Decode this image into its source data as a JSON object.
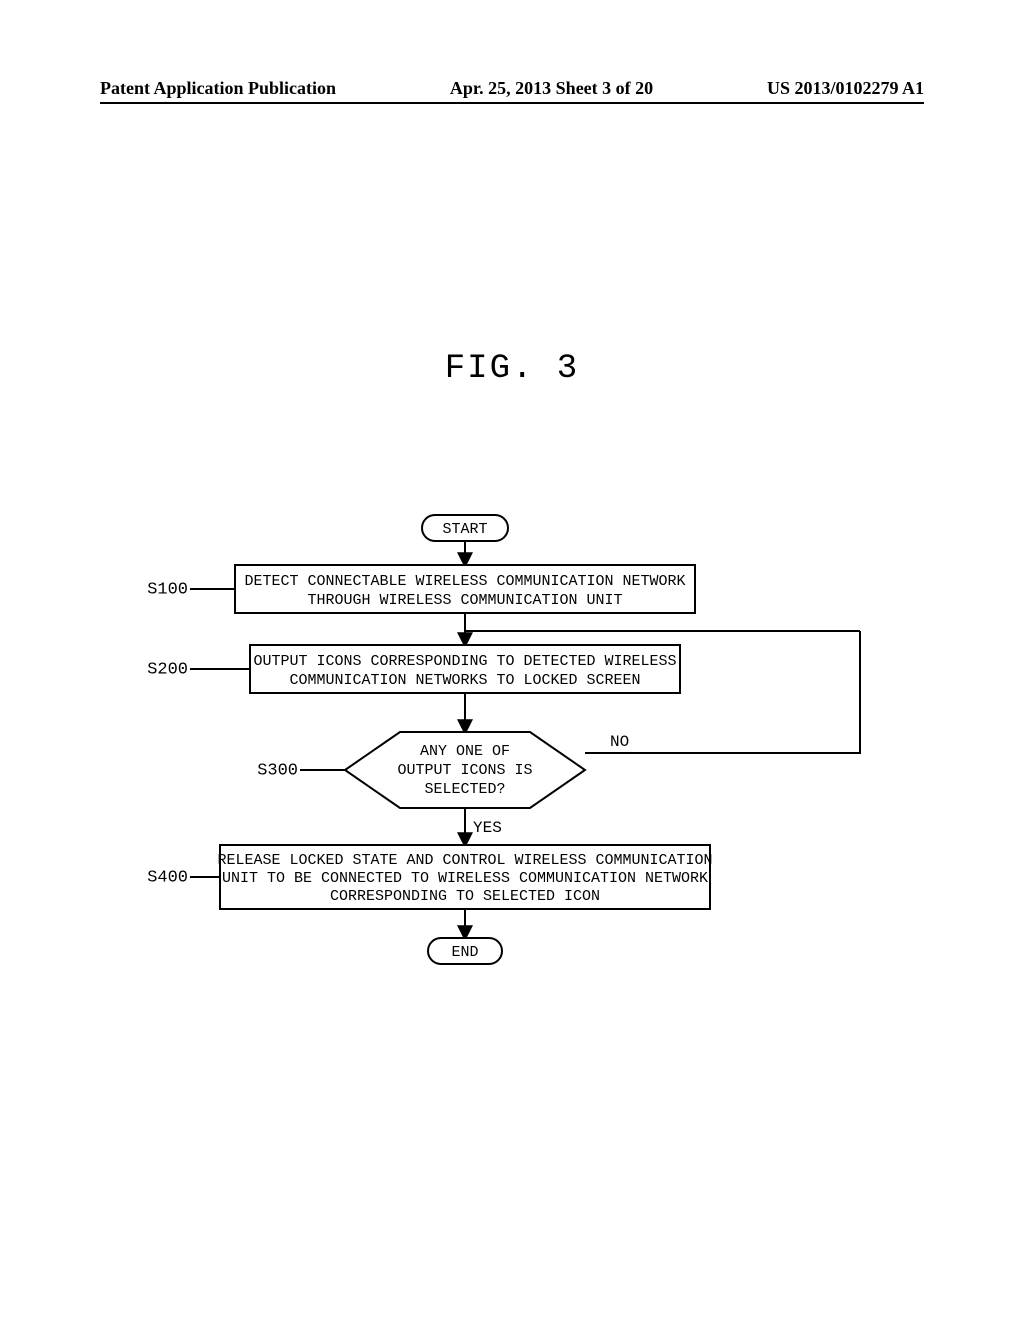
{
  "header": {
    "pub_type": "Patent Application Publication",
    "date_sheet": "Apr. 25, 2013  Sheet 3 of 20",
    "pub_number": "US 2013/0102279 A1"
  },
  "figure_title": "FIG. 3",
  "flowchart": {
    "start": "START",
    "end": "END",
    "steps": {
      "s100": {
        "label": "S100",
        "line1": "DETECT CONNECTABLE WIRELESS COMMUNICATION NETWORK",
        "line2": "THROUGH WIRELESS COMMUNICATION UNIT"
      },
      "s200": {
        "label": "S200",
        "line1": "OUTPUT ICONS CORRESPONDING TO DETECTED WIRELESS",
        "line2": "COMMUNICATION NETWORKS TO LOCKED SCREEN"
      },
      "s300": {
        "label": "S300",
        "line1": "ANY ONE OF",
        "line2": "OUTPUT ICONS IS",
        "line3": "SELECTED?"
      },
      "s400": {
        "label": "S400",
        "line1": "RELEASE LOCKED STATE AND CONTROL WIRELESS COMMUNICATION",
        "line2": "UNIT TO BE CONNECTED TO WIRELESS COMMUNICATION NETWORK",
        "line3": "CORRESPONDING TO SELECTED ICON"
      }
    },
    "edges": {
      "yes": "YES",
      "no": "NO"
    }
  }
}
